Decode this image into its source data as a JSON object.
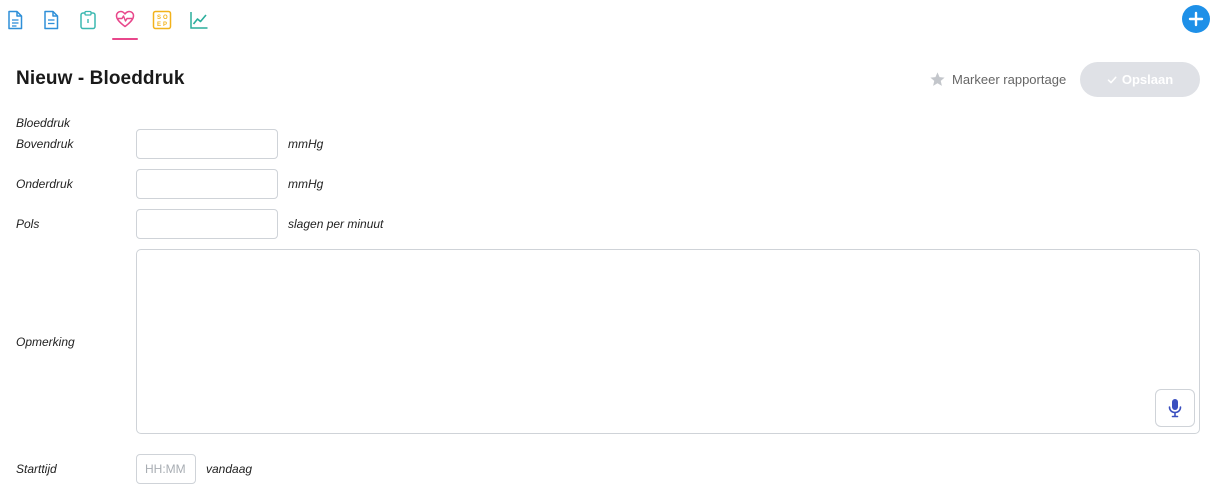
{
  "toolbar": {
    "tabs": [
      {
        "icon": "document-icon",
        "color": "#2f8fd8"
      },
      {
        "icon": "document-lines-icon",
        "color": "#2f8fd8"
      },
      {
        "icon": "clipboard-icon",
        "color": "#3bb8b0"
      },
      {
        "icon": "heart-pulse-icon",
        "color": "#e8478b",
        "active": true
      },
      {
        "icon": "soep-icon",
        "color": "#f2b21b",
        "letters": [
          "S",
          "O",
          "E",
          "P"
        ]
      },
      {
        "icon": "line-chart-icon",
        "color": "#2aae9c"
      }
    ],
    "add_icon": "plus-icon",
    "add_color": "#1e90e8"
  },
  "header": {
    "title": "Nieuw - Bloeddruk",
    "mark_label": "Markeer rapportage",
    "mark_icon": "star-icon",
    "save_label": "Opslaan",
    "save_icon": "check-icon"
  },
  "form": {
    "section_label": "Bloeddruk",
    "systolic": {
      "label": "Bovendruk",
      "value": "",
      "unit": "mmHg"
    },
    "diastolic": {
      "label": "Onderdruk",
      "value": "",
      "unit": "mmHg"
    },
    "pulse": {
      "label": "Pols",
      "value": "",
      "unit": "slagen per minuut"
    },
    "remark": {
      "label": "Opmerking",
      "value": "",
      "mic_icon": "microphone-icon"
    },
    "start_time": {
      "label": "Starttijd",
      "value": "",
      "placeholder": "HH:MM",
      "day": "vandaag"
    }
  },
  "colors": {
    "accent_pink": "#e8478b",
    "accent_blue": "#1e90e8",
    "save_disabled": "#dfe1e6",
    "mic_icon": "#3a4fbf"
  }
}
